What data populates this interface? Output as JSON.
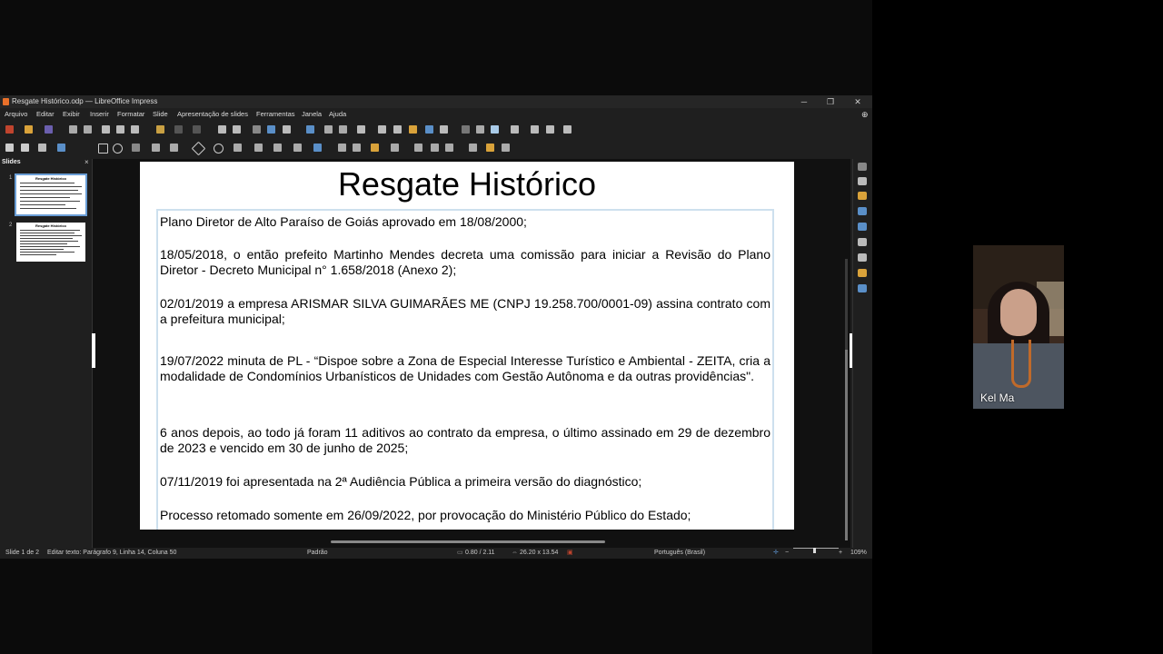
{
  "window": {
    "title": "Resgate Histórico.odp — LibreOffice Impress",
    "controls": {
      "minimize": "─",
      "maximize": "❐",
      "close": "✕"
    }
  },
  "menu": [
    "Arquivo",
    "Editar",
    "Exibir",
    "Inserir",
    "Formatar",
    "Slide",
    "Apresentação de slides",
    "Ferramentas",
    "Janela",
    "Ajuda"
  ],
  "slides_panel": {
    "title": "Slides",
    "close": "×",
    "thumbnails": [
      {
        "number": "1",
        "title": "Resgate Histórico"
      },
      {
        "number": "2",
        "title": "Resgate Histórico"
      }
    ]
  },
  "slide": {
    "title": "Resgate Histórico",
    "paragraphs": [
      "Plano Diretor de Alto Paraíso de Goiás aprovado em 18/08/2000;",
      "18/05/2018, o então prefeito Martinho Mendes decreta uma comissão para iniciar a Revisão do Plano Diretor - Decreto Municipal n° 1.658/2018 (Anexo 2);",
      "02/01/2019 a empresa ARISMAR SILVA GUIMARÃES ME (CNPJ 19.258.700/0001-09) assina contrato com a prefeitura municipal;",
      "19/07/2022 minuta de PL - “Dispoe sobre a Zona de Especial Interesse Turístico e Ambiental - ZEITA, cria a modalidade de Condomínios Urbanísticos de Unidades com Gestão Autônoma e da outras providências\".",
      "6 anos depois, ao todo já foram 11 aditivos ao contrato da empresa, o último assinado em 29 de dezembro de 2023 e vencido em 30 de junho de 2025;",
      "07/11/2019 foi apresentada na 2ª Audiência Pública a primeira versão do diagnóstico;",
      "Processo retomado somente em 26/09/2022, por provocação do Ministério Público do Estado;"
    ]
  },
  "statusbar": {
    "slide": "Slide 1 de 2",
    "edit": "Editar texto: Parágrafo 9, Linha 14, Coluna 50",
    "layout": "Padrão",
    "position": "0.80 / 2.11",
    "size": "26.20 x 13.54",
    "language": "Português (Brasil)",
    "zoom": "109%",
    "zoom_minus": "−",
    "zoom_plus": "+"
  },
  "participant": {
    "name": "Kel Ma"
  },
  "colors": {
    "accent": "#5a8fc8",
    "window_bg": "#1f1f1f",
    "selection_border": "#cde0ee"
  }
}
